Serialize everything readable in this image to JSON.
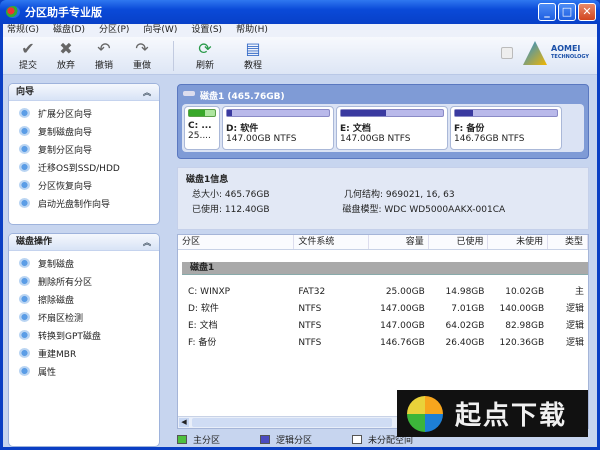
{
  "window": {
    "title": "分区助手专业版"
  },
  "menu": [
    "常规(G)",
    "磁盘(D)",
    "分区(P)",
    "向导(W)",
    "设置(S)",
    "帮助(H)"
  ],
  "toolbar": [
    {
      "label": "提交",
      "icon": "check-icon"
    },
    {
      "label": "放弃",
      "icon": "x-icon"
    },
    {
      "label": "撤销",
      "icon": "undo-icon"
    },
    {
      "label": "重做",
      "icon": "redo-icon"
    },
    {
      "label": "刷新",
      "icon": "refresh-icon"
    },
    {
      "label": "教程",
      "icon": "book-icon"
    }
  ],
  "brand": {
    "name": "AOMEI",
    "sub": "TECHNOLOGY"
  },
  "wizards": {
    "title": "向导",
    "items": [
      "扩展分区向导",
      "复制磁盘向导",
      "复制分区向导",
      "迁移OS到SSD/HDD",
      "分区恢复向导",
      "启动光盘制作向导"
    ]
  },
  "disk_ops": {
    "title": "磁盘操作",
    "items": [
      "复制磁盘",
      "删除所有分区",
      "擦除磁盘",
      "坏扇区检测",
      "转换到GPT磁盘",
      "重建MBR",
      "属性"
    ]
  },
  "disk": {
    "title": "磁盘1 (465.76GB)",
    "partitions": [
      {
        "name": "C: ...",
        "detail": "25....",
        "used_pct": 60,
        "type": "primary"
      },
      {
        "name": "D: 软件",
        "detail": "147.00GB NTFS",
        "used_pct": 5,
        "type": "logical"
      },
      {
        "name": "E: 文档",
        "detail": "147.00GB NTFS",
        "used_pct": 44,
        "type": "logical"
      },
      {
        "name": "F: 备份",
        "detail": "146.76GB NTFS",
        "used_pct": 18,
        "type": "logical"
      }
    ]
  },
  "info": {
    "title": "磁盘1信息",
    "total_label": "总大小:",
    "total": "465.76GB",
    "geo_label": "几何结构:",
    "geo": "969021, 16, 63",
    "used_label": "已使用:",
    "used": "112.40GB",
    "model_label": "磁盘模型:",
    "model": "WDC WD5000AAKX-001CA"
  },
  "table": {
    "headers": [
      "分区",
      "文件系统",
      "容量",
      "已使用",
      "未使用",
      "类型"
    ],
    "group": "磁盘1",
    "rows": [
      [
        "C: WINXP",
        "FAT32",
        "25.00GB",
        "14.98GB",
        "10.02GB",
        "主"
      ],
      [
        "D: 软件",
        "NTFS",
        "147.00GB",
        "7.01GB",
        "140.00GB",
        "逻辑"
      ],
      [
        "E: 文档",
        "NTFS",
        "147.00GB",
        "64.02GB",
        "82.98GB",
        "逻辑"
      ],
      [
        "F: 备份",
        "NTFS",
        "146.76GB",
        "26.40GB",
        "120.36GB",
        "逻辑"
      ]
    ]
  },
  "legend": [
    "主分区",
    "逻辑分区",
    "未分配空间"
  ],
  "watermark": "起点下载",
  "colors": {
    "primary": "#38a829",
    "logical": "#3a3aa0"
  }
}
